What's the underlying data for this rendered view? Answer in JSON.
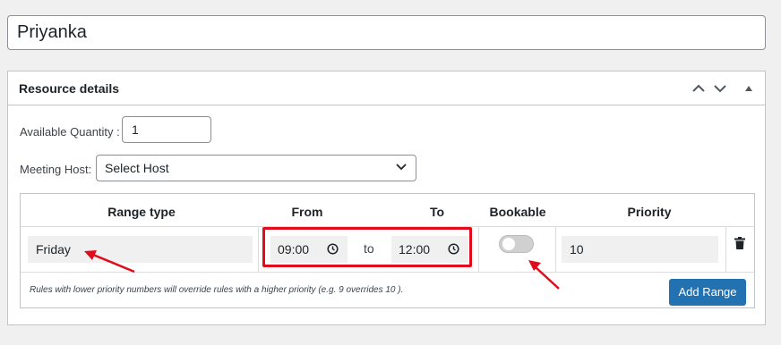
{
  "title": {
    "value": "Priyanka"
  },
  "panel": {
    "title": "Resource details"
  },
  "quantity": {
    "label": "Available Quantity :",
    "value": "1"
  },
  "host": {
    "label": "Meeting Host:",
    "selected": "Select Host"
  },
  "table": {
    "headers": [
      "Range type",
      "From",
      "To",
      "Bookable",
      "Priority"
    ],
    "row": {
      "range_type": "Friday",
      "from": "09:00",
      "to_label": "to",
      "to": "12:00",
      "bookable": false,
      "priority": "10"
    },
    "note": "Rules with lower priority numbers will override rules with a higher priority (e.g. 9 overrides 10 ).",
    "add_button": "Add Range"
  },
  "icons": [
    "chevron-up-icon",
    "chevron-down-icon",
    "triangle-up-icon",
    "clock-icon",
    "trash-icon",
    "select-chevron-icon"
  ],
  "colors": {
    "primary": "#2271b1",
    "annotation": "#e10b1c"
  }
}
